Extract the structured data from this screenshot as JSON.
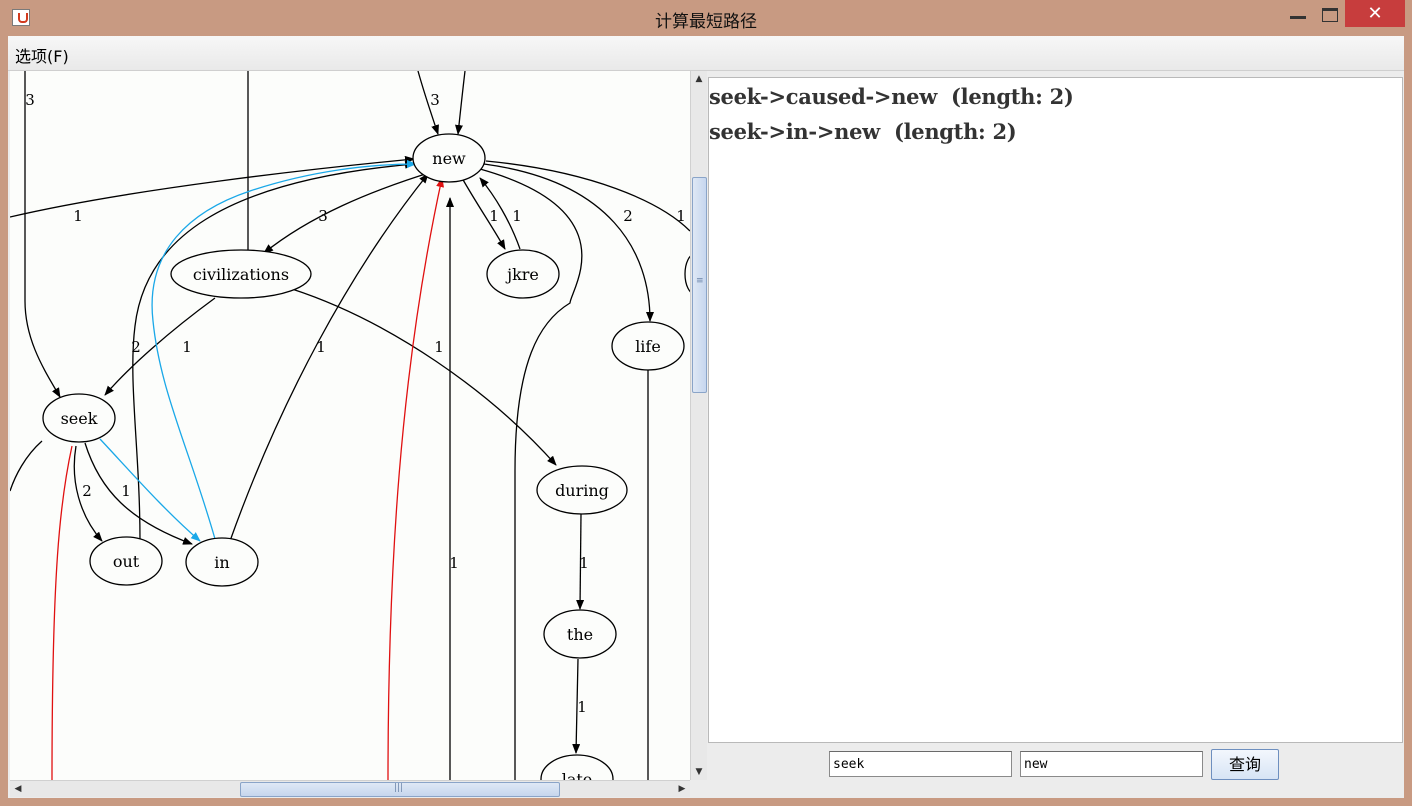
{
  "window": {
    "title": "计算最短路径",
    "close_glyph": "✕"
  },
  "menu": {
    "options_label": "选项(F)"
  },
  "graph": {
    "nodes": {
      "new": "new",
      "civilizations": "civilizations",
      "jkre": "jkre",
      "life": "life",
      "seek": "seek",
      "during": "during",
      "out": "out",
      "in": "in",
      "the": "the",
      "late": "late"
    },
    "edge_labels": {
      "top_left_3": "3",
      "top_mid_3": "3",
      "left_1": "1",
      "civ_3": "3",
      "jkre_1a": "1",
      "jkre_1b": "1",
      "life_2": "2",
      "right_1": "1",
      "out_2": "2",
      "civ_seek_1": "1",
      "in_new_1": "1",
      "civ_during_1": "1",
      "seek_out_2": "2",
      "seek_in_1": "1",
      "vertical_1": "1",
      "during_the_1": "1",
      "the_late_1": "1"
    },
    "colors": {
      "highlight_blue": "#1aa8e8",
      "highlight_red": "#e01010",
      "edge": "#000000"
    }
  },
  "results": [
    "seek->caused->new  (length: 2)",
    "seek->in->new  (length: 2)"
  ],
  "query": {
    "from_value": "seek",
    "to_value": "new",
    "button_label": "查询"
  }
}
